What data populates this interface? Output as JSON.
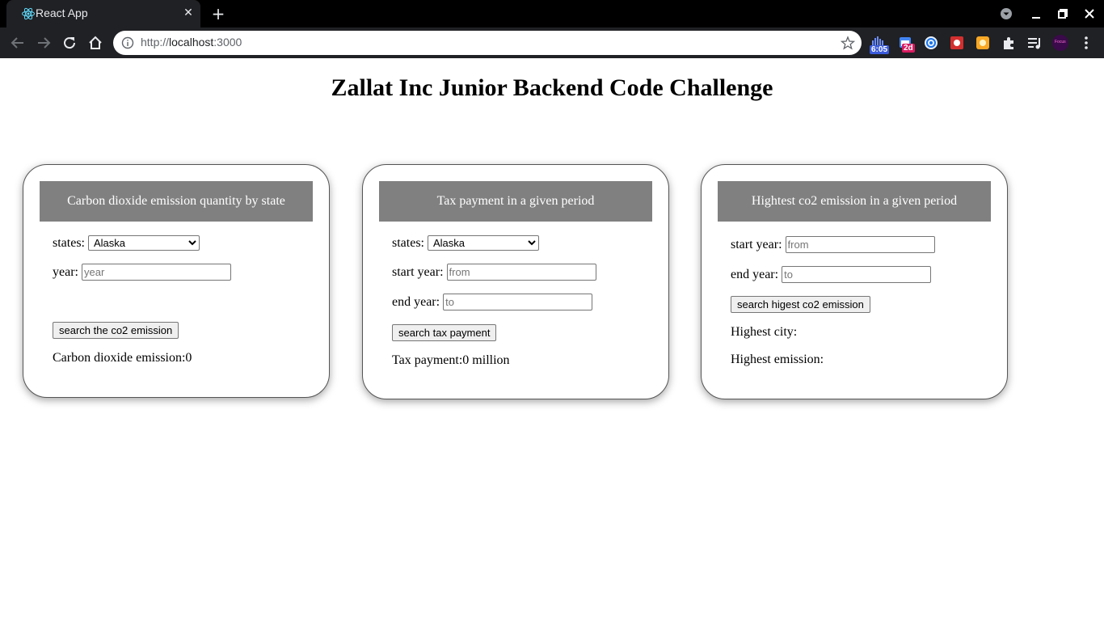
{
  "browser": {
    "tab_title": "React App",
    "url_host": "localhost",
    "url_prefix": "http://",
    "url_port": ":3000",
    "extensions": {
      "clock_badge": "6:05",
      "calendar_badge": "2d",
      "focus_label": "Focus"
    }
  },
  "page": {
    "title": "Zallat Inc Junior Backend Code Challenge"
  },
  "card_co2": {
    "heading": "Carbon dioxide emission quantity by state",
    "states_label": "states:",
    "states_selected": "Alaska",
    "year_label": "year:",
    "year_placeholder": "year",
    "button": "search the co2 emission",
    "result": "Carbon dioxide emission:0"
  },
  "card_tax": {
    "heading": "Tax payment in a given period",
    "states_label": "states:",
    "states_selected": "Alaska",
    "start_label": "start year:",
    "start_placeholder": "from",
    "end_label": "end year:",
    "end_placeholder": "to",
    "button": "search tax payment",
    "result": "Tax payment:0 million"
  },
  "card_highest": {
    "heading": "Hightest co2 emission in a given period",
    "start_label": "start year:",
    "start_placeholder": "from",
    "end_label": "end year:",
    "end_placeholder": "to",
    "button": "search higest co2 emission",
    "city_label": "Highest city:",
    "emission_label": "Highest emission:"
  }
}
